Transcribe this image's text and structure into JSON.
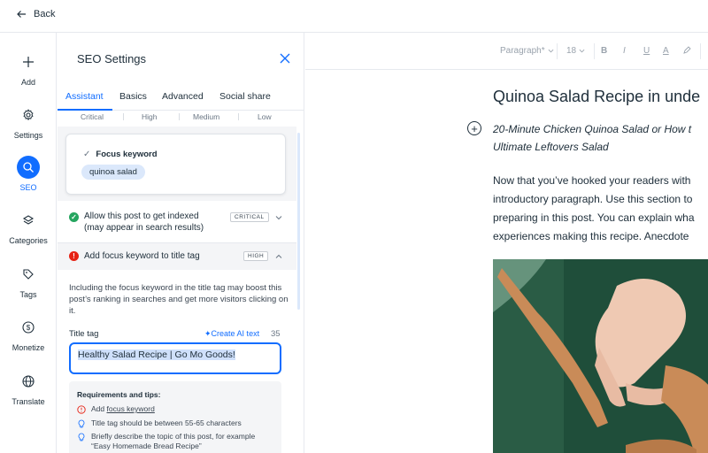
{
  "topbar": {
    "back_label": "Back"
  },
  "rail": {
    "items": [
      {
        "label": "Add",
        "icon": "plus-icon"
      },
      {
        "label": "Settings",
        "icon": "gear-icon"
      },
      {
        "label": "SEO",
        "icon": "search-icon",
        "active": true
      },
      {
        "label": "Categories",
        "icon": "categories-icon"
      },
      {
        "label": "Tags",
        "icon": "tag-icon"
      },
      {
        "label": "Monetize",
        "icon": "dollar-icon"
      },
      {
        "label": "Translate",
        "icon": "globe-icon"
      }
    ]
  },
  "panel": {
    "title": "SEO Settings",
    "tabs": [
      "Assistant",
      "Basics",
      "Advanced",
      "Social share"
    ],
    "active_tab": "Assistant",
    "levels": [
      "Critical",
      "High",
      "Medium",
      "Low"
    ],
    "focus_keyword": {
      "heading": "Focus keyword",
      "check": "✓",
      "value": "quinoa salad"
    },
    "checks": [
      {
        "text_line1": "Allow this post to get indexed",
        "text_line2": "(may appear in search results)",
        "badge": "CRITICAL",
        "status": "pass",
        "expanded": false
      },
      {
        "text_line1": "Add focus keyword to title tag",
        "badge": "HIGH",
        "status": "error",
        "expanded": true
      }
    ],
    "description": "Including the focus keyword in the title tag may boost this post’s ranking in searches and get more visitors clicking on it.",
    "title_tag": {
      "label": "Title tag",
      "ai_link": "✦Create AI text",
      "char_count": "35",
      "value": "Healthy Salad Recipe | Go Mo Goods!"
    },
    "tips": {
      "title": "Requirements and tips:",
      "items": [
        {
          "prefix": "Add ",
          "link": "focus keyword",
          "icon": "warning-icon"
        },
        {
          "text": "Title tag should be between 55-65 characters",
          "icon": "lightbulb-icon"
        },
        {
          "text_line1": "Briefly describe the topic of this post, for example",
          "text_line2": "“Easy Homemade Bread Recipe”",
          "icon": "lightbulb-icon"
        }
      ]
    },
    "colors": {
      "accent": "#116dff",
      "pass": "#25a55f",
      "error": "#e62214"
    }
  },
  "editor": {
    "toolbar": {
      "style_select": "Paragraph*",
      "size_select": "18",
      "bold": "B",
      "italic": "I",
      "underline": "U",
      "color": "A"
    },
    "title": "Quinoa Salad Recipe in unde",
    "subtitle_line1": "20-Minute Chicken Quinoa Salad or How t",
    "subtitle_line2": "Ultimate Leftovers Salad",
    "body": [
      "Now that you’ve hooked your readers with",
      "introductory paragraph. Use this section to",
      "preparing in this post. You can explain wha",
      "experiences making this recipe. Anecdote"
    ]
  }
}
